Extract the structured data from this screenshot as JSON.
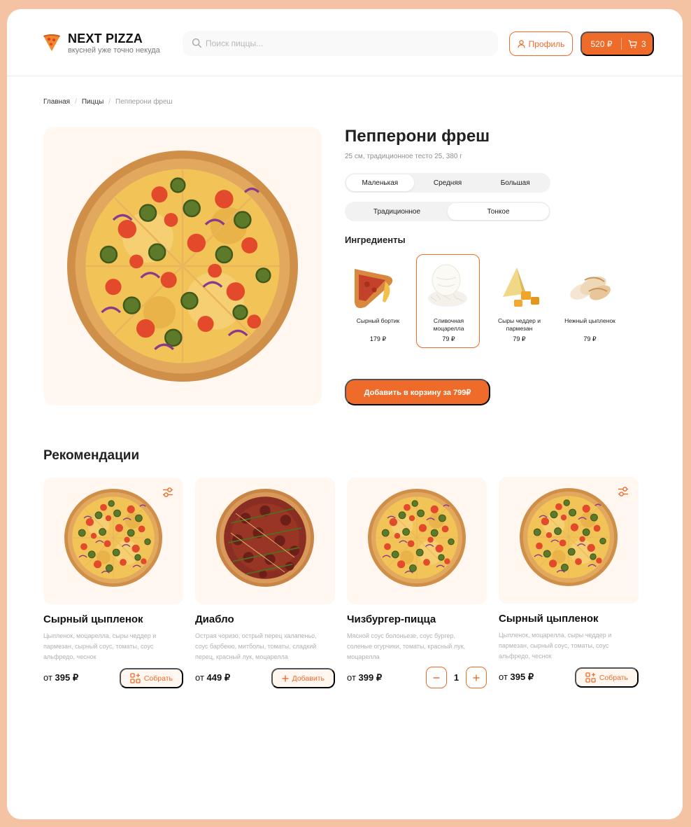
{
  "header": {
    "brand": "NEXT PIZZA",
    "tagline": "вкусней уже точно некуда",
    "search_placeholder": "Поиск пиццы...",
    "profile_label": "Профиль",
    "cart_sum": "520 ₽",
    "cart_count": "3"
  },
  "breadcrumbs": [
    "Главная",
    "Пиццы",
    "Пепперони фреш"
  ],
  "product": {
    "title": "Пепперони фреш",
    "description": "25 см, традиционное тесто 25, 380 г",
    "sizes": [
      "Маленькая",
      "Средняя",
      "Большая"
    ],
    "selected_size": "Маленькая",
    "doughs": [
      "Традиционное",
      "Тонкое"
    ],
    "selected_dough": "Тонкое",
    "ingredients_title": "Ингредиенты",
    "ingredients": [
      {
        "name": "Сырный бортик",
        "price": "179 ₽",
        "icon": "cheese-crust-icon",
        "selected": false
      },
      {
        "name": "Сливочная моцарелла",
        "price": "79 ₽",
        "icon": "mozzarella-icon",
        "selected": true
      },
      {
        "name": "Сыры чеддер и пармезан",
        "price": "79 ₽",
        "icon": "cheddar-parmesan-icon",
        "selected": false
      },
      {
        "name": "Нежный цыпленок",
        "price": "79 ₽",
        "icon": "chicken-icon",
        "selected": false
      }
    ],
    "add_button": "Добавить в корзину за 799₽"
  },
  "recommendations": {
    "title": "Рекомендации",
    "items": [
      {
        "name": "Сырный цыпленок",
        "description": "Цыпленок, моцарелла, сыры чеддер и пармезан, сырный соус, томаты, соус альфредо, чеснок",
        "price_prefix": "от",
        "price": "395 ₽",
        "action": "Собрать",
        "action_type": "build",
        "has_config": true
      },
      {
        "name": "Диабло",
        "description": "Острая чоризо, острый перец халапеньо, соус барбекю, митболы, томаты, сладкий перец, красный лук, моцарелла",
        "price_prefix": "от",
        "price": "449 ₽",
        "action": "Добавить",
        "action_type": "add",
        "has_config": false
      },
      {
        "name": "Чизбургер-пицца",
        "description": "Мясной соус болоньезе, соус бургер, соленые огурчики, томаты, красный лук, моцарелла",
        "price_prefix": "от",
        "price": "399 ₽",
        "action_type": "stepper",
        "quantity": "1",
        "has_config": false
      },
      {
        "name": "Сырный цыпленок",
        "description": "Цыпленок, моцарелла, сыры чеддер и пармезан, сырный соус, томаты, соус альфредо, чеснок",
        "price_prefix": "от",
        "price": "395 ₽",
        "action": "Собрать",
        "action_type": "build",
        "has_config": true
      }
    ]
  },
  "colors": {
    "accent": "#ef6b2a",
    "page_background": "#f4c3a3",
    "card_background": "#fff7f0"
  }
}
